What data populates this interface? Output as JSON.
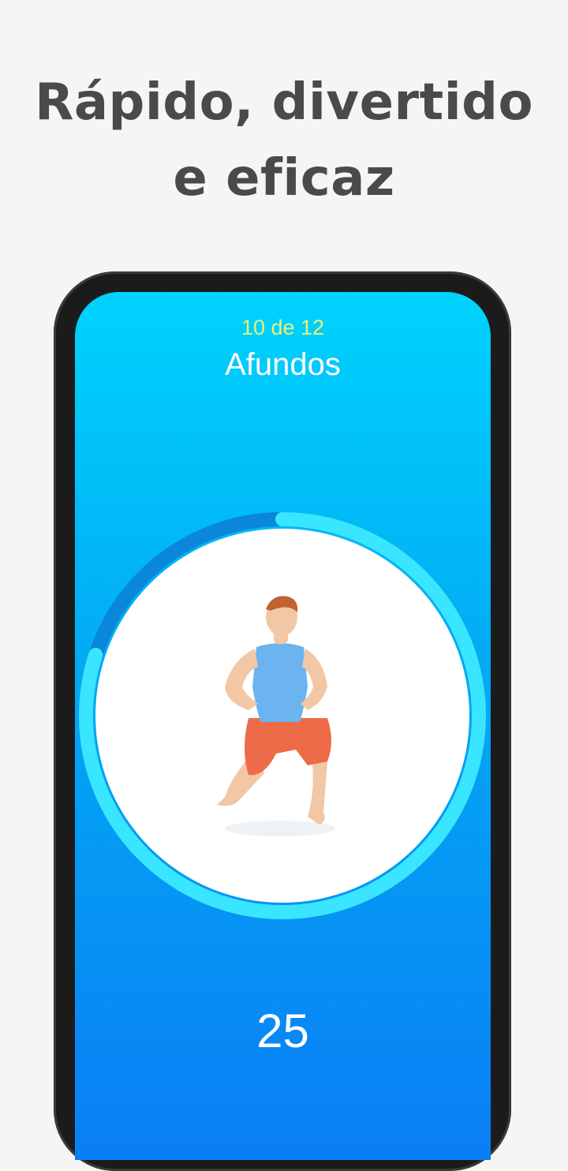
{
  "headline": {
    "line1": "Rápido, divertido",
    "line2": "e eficaz"
  },
  "workout": {
    "counter": "10 de 12",
    "exercise_name": "Afundos",
    "reps": "25",
    "progress_fraction": 0.8,
    "illustration_icon": "lunge-exercise-figure"
  },
  "colors": {
    "headline": "#4a4a4a",
    "counter": "#e9f07a",
    "ring_progress": "#3ae6ff",
    "ring_track": "#0a86db",
    "screen_top": "#00d3fd",
    "screen_bottom": "#0a7ef5"
  }
}
